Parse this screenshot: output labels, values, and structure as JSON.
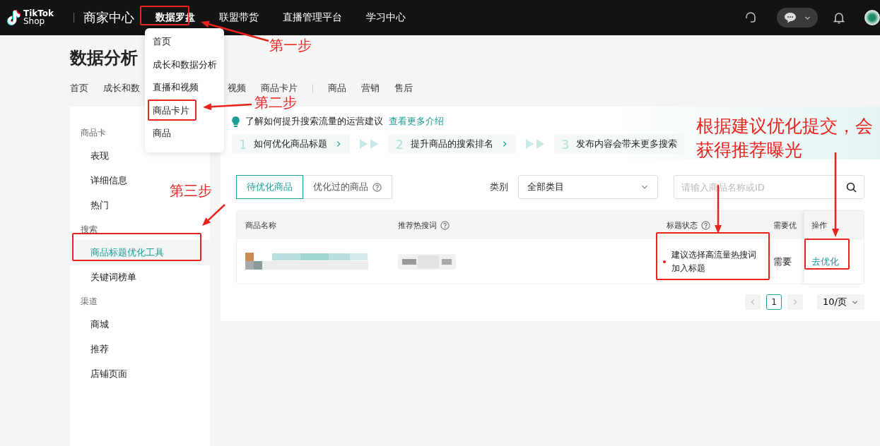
{
  "topbar": {
    "logo_top": "TikTok",
    "logo_bottom": "Shop",
    "portal": "商家中心",
    "nav": [
      "数据罗盘",
      "联盟带货",
      "直播管理平台",
      "学习中心"
    ]
  },
  "dropdown": [
    "首页",
    "成长和数据分析",
    "直播和视频",
    "商品卡片",
    "商品"
  ],
  "page_title": "数据分析",
  "subnav": [
    [
      {
        "label": "首页"
      },
      {
        "label": "成长和数",
        "cut": true
      },
      {
        "label": "视频"
      },
      {
        "label": "商品卡片"
      }
    ],
    [
      {
        "label": "商品"
      },
      {
        "label": "营销"
      },
      {
        "label": "售后"
      }
    ]
  ],
  "sidebar": [
    {
      "title": "商品卡",
      "items": [
        {
          "label": "表现",
          "selected": false
        },
        {
          "label": "详细信息",
          "selected": false
        },
        {
          "label": "热门",
          "selected": false
        }
      ]
    },
    {
      "title": "搜索",
      "items": [
        {
          "label": "商品标题优化工具",
          "selected": true
        },
        {
          "label": "关键词榜单",
          "selected": false
        }
      ]
    },
    {
      "title": "渠道",
      "items": [
        {
          "label": "商城",
          "selected": false
        },
        {
          "label": "推荐",
          "selected": false
        },
        {
          "label": "店铺页面",
          "selected": false
        }
      ]
    }
  ],
  "tip": {
    "text": "了解如何提升搜索流量的运营建议",
    "link": "查看更多介绍"
  },
  "steps": [
    {
      "number": "1",
      "label": "如何优化商品标题",
      "chevron": true
    },
    {
      "number": "2",
      "label": "提升商品的搜索排名",
      "chevron": true
    },
    {
      "number": "3",
      "label": "发布内容会带来更多搜索",
      "chevron": false
    }
  ],
  "tabs": [
    {
      "label": "待优化商品",
      "selected": true,
      "help": false
    },
    {
      "label": "优化过的商品",
      "selected": false,
      "help": true
    }
  ],
  "category": {
    "label": "类别",
    "value": "全部类目"
  },
  "search": {
    "placeholder": "请输入商品名称或ID"
  },
  "table": {
    "columns": [
      {
        "label": "商品名称"
      },
      {
        "label": "推荐热搜词",
        "help": true
      },
      {
        "label": "标题状态",
        "help": true
      },
      {
        "label": "需要优"
      },
      {
        "label": "操作"
      }
    ],
    "rows": [
      {
        "status": "建议选择高流量热搜词加入标题",
        "column_4": "需要",
        "action": "去优化"
      }
    ]
  },
  "pagination": {
    "pages": [
      {
        "label": "1",
        "selected": true
      }
    ],
    "page_size": "10/页"
  },
  "annotations": {
    "steps": [
      "第一步",
      "第二步",
      "第三步"
    ],
    "callout": [
      "根据建议优化提交，会",
      "获得推荐曝光"
    ]
  }
}
